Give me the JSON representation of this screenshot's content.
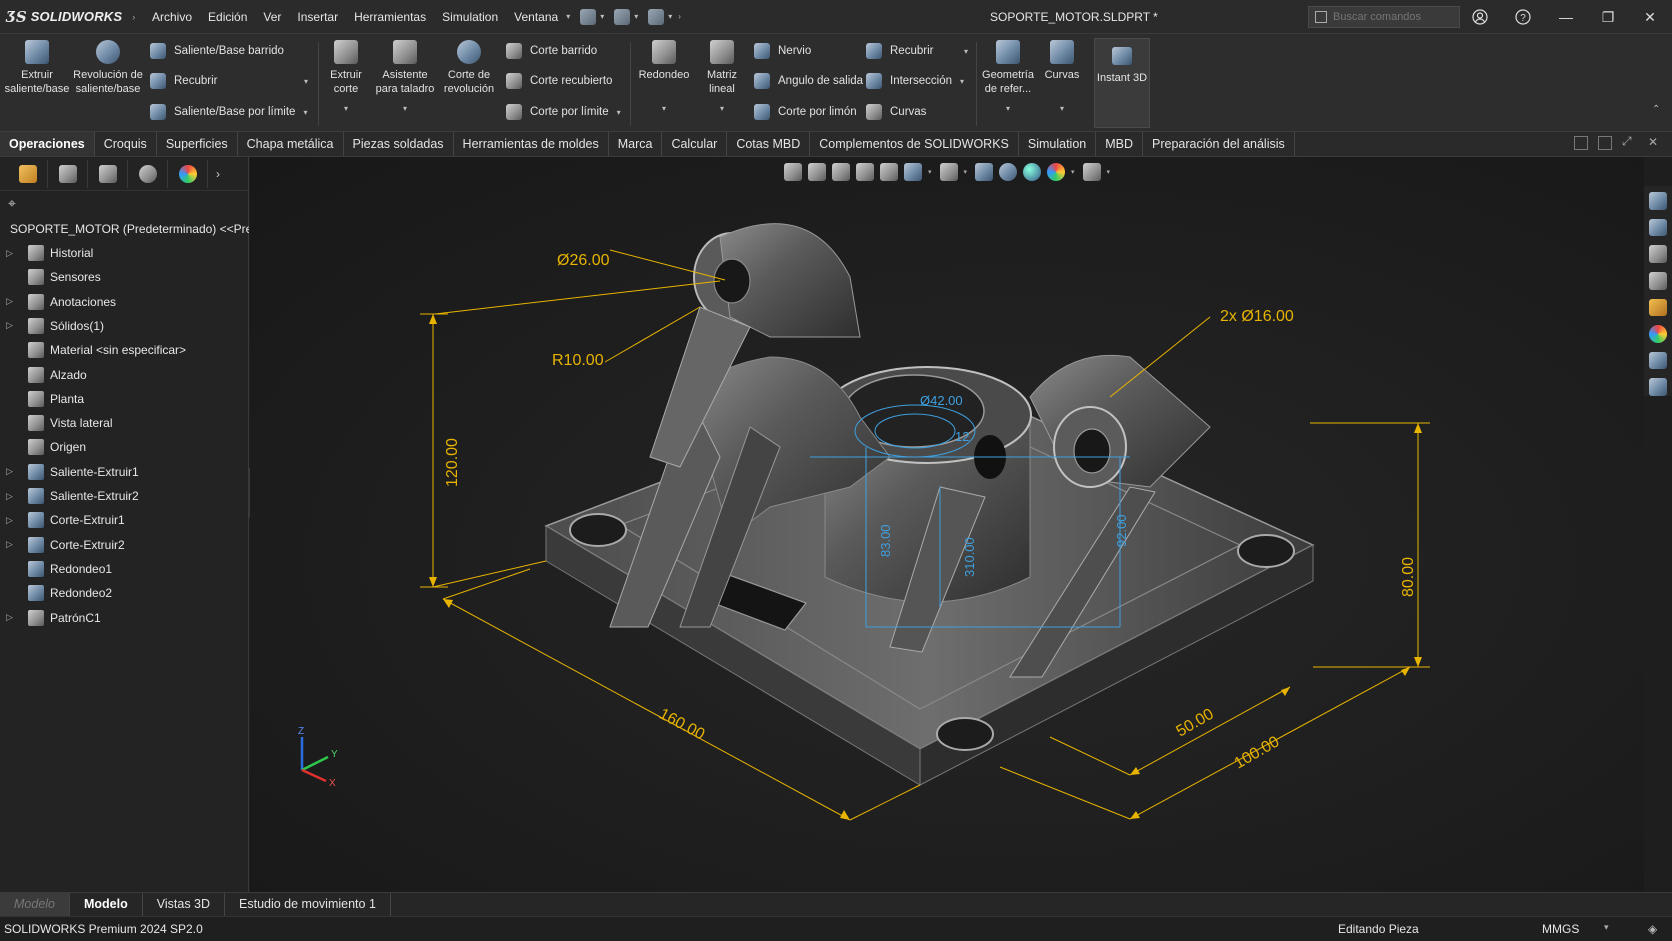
{
  "app": {
    "logo_text": "SOLIDWORKS",
    "document_title": "SOPORTE_MOTOR.SLDPRT *",
    "search_placeholder": "Buscar comandos"
  },
  "menus": [
    "Archivo",
    "Edición",
    "Ver",
    "Insertar",
    "Herramientas",
    "Simulation",
    "Ventana"
  ],
  "ribbon": {
    "extruir_saliente": "Extruir saliente/base",
    "revolucion_saliente": "Revolución de saliente/base",
    "saliente_barrido": "Saliente/Base barrido",
    "recubrir": "Recubrir",
    "saliente_limite": "Saliente/Base por límite",
    "extruir_corte": "Extruir corte",
    "asistente_taladro": "Asistente para taladro",
    "corte_revolucion": "Corte de revolución",
    "corte_barrido": "Corte barrido",
    "corte_recubierto": "Corte recubierto",
    "corte_limite": "Corte por límite",
    "redondeo": "Redondeo",
    "matriz_lineal": "Matriz lineal",
    "nervio": "Nervio",
    "angulo_salida": "Angulo de salida",
    "corte_limon": "Corte por limón",
    "recubrir2": "Recubrir",
    "interseccion": "Intersección",
    "curvas_small": "Curvas",
    "geometria_ref": "Geometría de refer...",
    "curvas": "Curvas",
    "instant3d": "Instant 3D"
  },
  "tabs": [
    "Operaciones",
    "Croquis",
    "Superficies",
    "Chapa metálica",
    "Piezas soldadas",
    "Herramientas de moldes",
    "Marca",
    "Calcular",
    "Cotas MBD",
    "Complementos de SOLIDWORKS",
    "Simulation",
    "MBD",
    "Preparación del análisis"
  ],
  "tree": {
    "root": "SOPORTE_MOTOR (Predeterminado) <<Pre",
    "items": [
      {
        "label": "Historial",
        "expandable": true,
        "icon": "history-icon"
      },
      {
        "label": "Sensores",
        "expandable": false,
        "icon": "sensor-icon"
      },
      {
        "label": "Anotaciones",
        "expandable": true,
        "icon": "annotation-icon"
      },
      {
        "label": "Sólidos(1)",
        "expandable": true,
        "icon": "solid-bodies-icon"
      },
      {
        "label": "Material <sin especificar>",
        "expandable": false,
        "icon": "material-icon"
      },
      {
        "label": "Alzado",
        "expandable": false,
        "icon": "plane-icon"
      },
      {
        "label": "Planta",
        "expandable": false,
        "icon": "plane-icon"
      },
      {
        "label": "Vista lateral",
        "expandable": false,
        "icon": "plane-icon"
      },
      {
        "label": "Origen",
        "expandable": false,
        "icon": "origin-icon"
      },
      {
        "label": "Saliente-Extruir1",
        "expandable": true,
        "icon": "extrude-icon"
      },
      {
        "label": "Saliente-Extruir2",
        "expandable": true,
        "icon": "extrude-icon"
      },
      {
        "label": "Corte-Extruir1",
        "expandable": true,
        "icon": "cut-extrude-icon"
      },
      {
        "label": "Corte-Extruir2",
        "expandable": true,
        "icon": "cut-extrude-icon"
      },
      {
        "label": "Redondeo1",
        "expandable": false,
        "icon": "fillet-icon"
      },
      {
        "label": "Redondeo2",
        "expandable": false,
        "icon": "fillet-icon"
      },
      {
        "label": "PatrónC1",
        "expandable": true,
        "icon": "pattern-icon"
      }
    ]
  },
  "dimensions": {
    "d26": "Ø26.00",
    "r10": "R10.00",
    "d16": "2x Ø16.00",
    "h120": "120.00",
    "l160": "160.00",
    "w50": "50.00",
    "w100": "100.00",
    "h80": "80.00",
    "inner_a": "Ø42.00",
    "inner_b": "12",
    "inner_c": "83.00",
    "inner_d": "310.00",
    "inner_e": "92.00"
  },
  "model_tabs": [
    "Modelo",
    "Modelo",
    "Vistas 3D",
    "Estudio de movimiento 1"
  ],
  "status": {
    "version": "SOLIDWORKS Premium 2024 SP2.0",
    "mode": "Editando Pieza",
    "units": "MMGS"
  },
  "colors": {
    "dimension_yellow": "#e8b400",
    "dimension_blue": "#3fa0e0",
    "background": "#1e1e1e"
  }
}
